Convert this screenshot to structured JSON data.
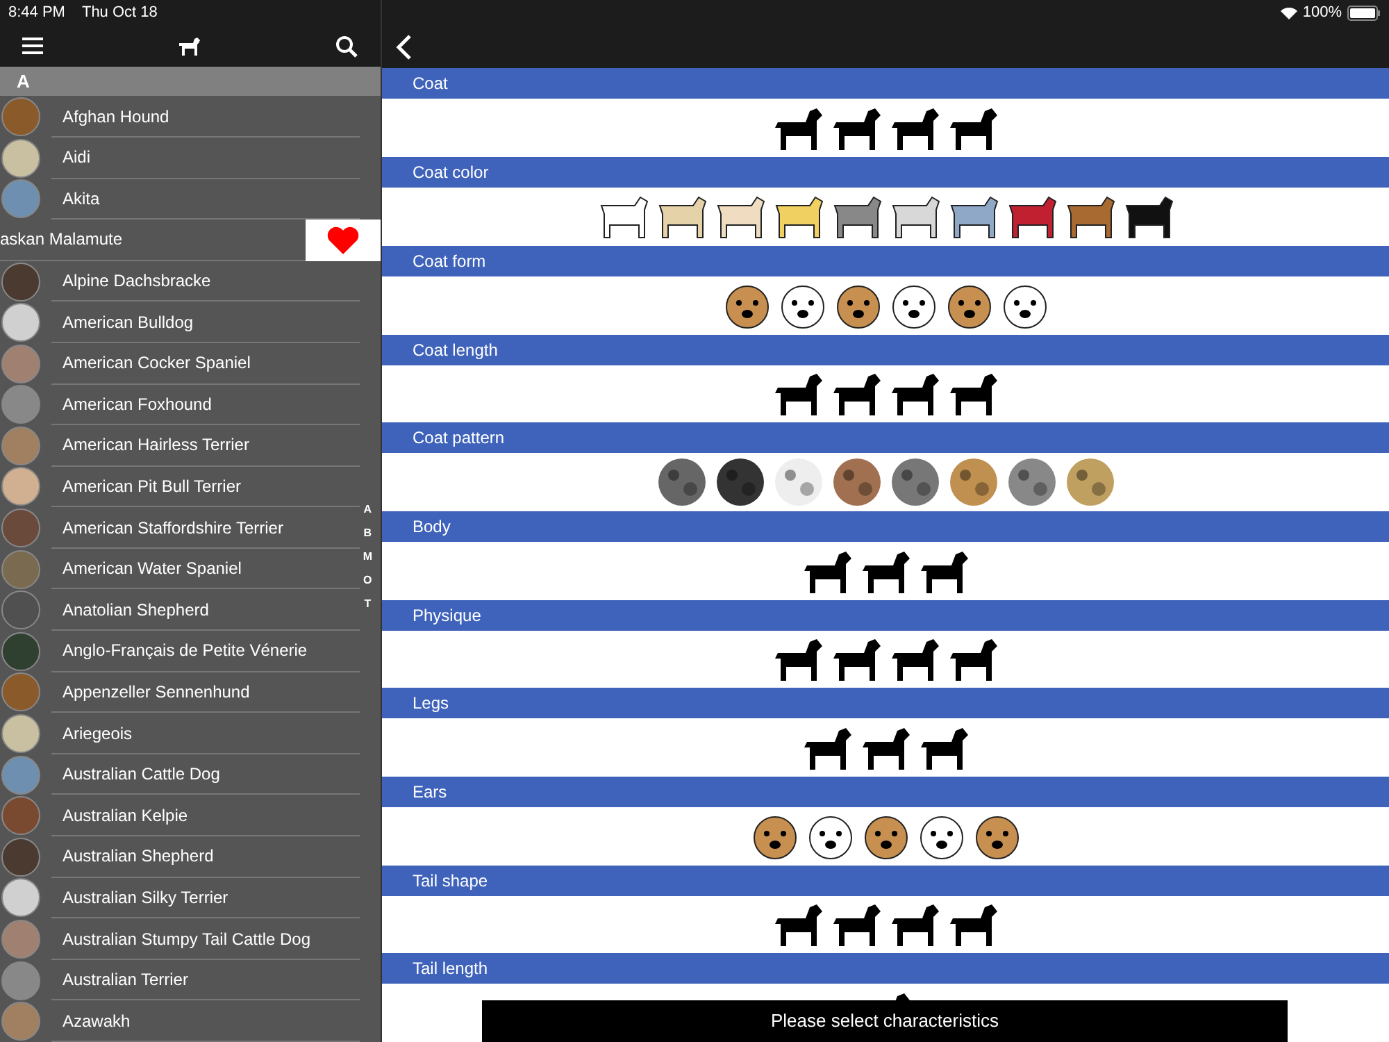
{
  "status_bar": {
    "time": "8:44 PM",
    "date": "Thu Oct 18",
    "battery": "100%"
  },
  "list": {
    "section": "A",
    "rows": [
      {
        "name": "Afghan Hound",
        "kind": "normal"
      },
      {
        "name": "Aidi",
        "kind": "normal"
      },
      {
        "name": "Akita",
        "kind": "normal"
      },
      {
        "name": "askan Malamute",
        "kind": "swiped"
      },
      {
        "name": "Alpine Dachsbracke",
        "kind": "normal"
      },
      {
        "name": "American Bulldog",
        "kind": "normal"
      },
      {
        "name": "American Cocker Spaniel",
        "kind": "normal"
      },
      {
        "name": "American Foxhound",
        "kind": "normal"
      },
      {
        "name": "American Hairless Terrier",
        "kind": "normal"
      },
      {
        "name": "American Pit Bull Terrier",
        "kind": "normal"
      },
      {
        "name": "American Staffordshire Terrier",
        "kind": "normal"
      },
      {
        "name": "American Water Spaniel",
        "kind": "normal"
      },
      {
        "name": "Anatolian Shepherd",
        "kind": "normal"
      },
      {
        "name": "Anglo-Français de Petite Vénerie",
        "kind": "normal"
      },
      {
        "name": "Appenzeller Sennenhund",
        "kind": "normal"
      },
      {
        "name": "Ariegeois",
        "kind": "normal"
      },
      {
        "name": "Australian Cattle Dog",
        "kind": "normal"
      },
      {
        "name": "Australian Kelpie",
        "kind": "normal"
      },
      {
        "name": "Australian Shepherd",
        "kind": "normal"
      },
      {
        "name": "Australian Silky Terrier",
        "kind": "normal"
      },
      {
        "name": "Australian Stumpy Tail Cattle Dog",
        "kind": "normal"
      },
      {
        "name": "Australian Terrier",
        "kind": "normal"
      },
      {
        "name": "Azawakh",
        "kind": "normal"
      }
    ]
  },
  "index_letters": [
    "A",
    "B",
    "M",
    "O",
    "T"
  ],
  "sections": [
    {
      "title": "Coat",
      "kind": "silhouette"
    },
    {
      "title": "Coat color",
      "kind": "color"
    },
    {
      "title": "Coat form",
      "kind": "face"
    },
    {
      "title": "Coat length",
      "kind": "silhouette"
    },
    {
      "title": "Coat pattern",
      "kind": "pattern"
    },
    {
      "title": "Body",
      "kind": "silhouette"
    },
    {
      "title": "Physique",
      "kind": "silhouette"
    },
    {
      "title": "Legs",
      "kind": "silhouette"
    },
    {
      "title": "Ears",
      "kind": "face"
    },
    {
      "title": "Tail shape",
      "kind": "silhouette"
    },
    {
      "title": "Tail length",
      "kind": "silhouette"
    }
  ],
  "toast": "Please select characteristics"
}
